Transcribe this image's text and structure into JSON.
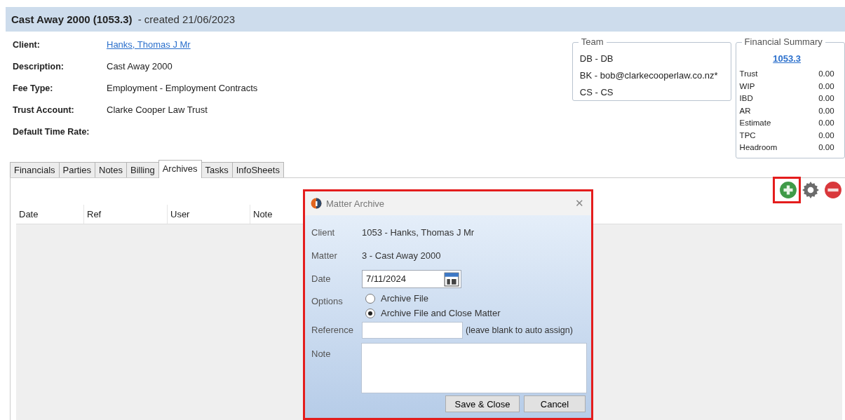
{
  "header": {
    "title": "Cast Away 2000 (1053.3)",
    "subtitle": "- created 21/06/2023"
  },
  "details": [
    {
      "label": "Client:",
      "value": "Hanks, Thomas J Mr",
      "kind": "link"
    },
    {
      "label": "Description:",
      "value": "Cast Away 2000",
      "kind": "text"
    },
    {
      "label": "Fee Type:",
      "value": "Employment - Employment Contracts",
      "kind": "text"
    },
    {
      "label": "Trust Account:",
      "value": "Clarke Cooper Law Trust",
      "kind": "text"
    },
    {
      "label": "Default Time Rate:"
    }
  ],
  "team": {
    "title": "Team",
    "members": [
      "DB - DB",
      "BK - bob@clarkecooperlaw.co.nz*",
      "CS - CS"
    ]
  },
  "financial_summary": {
    "title": "Financial Summary",
    "link": "1053.3",
    "rows": [
      {
        "label": "Trust",
        "value": "0.00"
      },
      {
        "label": "WIP",
        "value": "0.00"
      },
      {
        "label": "IBD",
        "value": "0.00"
      },
      {
        "label": "AR",
        "value": "0.00"
      },
      {
        "label": "Estimate",
        "value": "0.00"
      },
      {
        "label": "TPC",
        "value": "0.00"
      },
      {
        "label": "Headroom",
        "value": "0.00"
      }
    ]
  },
  "tabs": [
    {
      "label": "Financials",
      "selected": false
    },
    {
      "label": "Parties",
      "selected": false
    },
    {
      "label": "Notes",
      "selected": false
    },
    {
      "label": "Billing",
      "selected": false
    },
    {
      "label": "Archives",
      "selected": true
    },
    {
      "label": "Tasks",
      "selected": false
    },
    {
      "label": "InfoSheets",
      "selected": false
    }
  ],
  "toolbar": [
    {
      "kind": "add",
      "highlighted": true
    },
    {
      "kind": "settings",
      "highlighted": false
    },
    {
      "kind": "remove",
      "highlighted": false
    }
  ],
  "table": {
    "columns": [
      "Date",
      "Ref",
      "User",
      "Note"
    ]
  },
  "dialog": {
    "title": "Matter Archive",
    "close": "✕",
    "highlighted": true,
    "client_label": "Client",
    "client": "1053 - Hanks, Thomas J Mr",
    "matter_label": "Matter",
    "matter": "3 - Cast Away 2000",
    "date_label": "Date",
    "date": "7/11/2024",
    "options_label": "Options",
    "options": [
      {
        "label": "Archive File",
        "selected": false
      },
      {
        "label": "Archive File and Close Matter",
        "selected": true
      }
    ],
    "reference_label": "Reference",
    "reference_hint": "(leave blank to auto assign)",
    "note_label": "Note",
    "buttons": [
      "Save & Close",
      "Cancel"
    ]
  }
}
